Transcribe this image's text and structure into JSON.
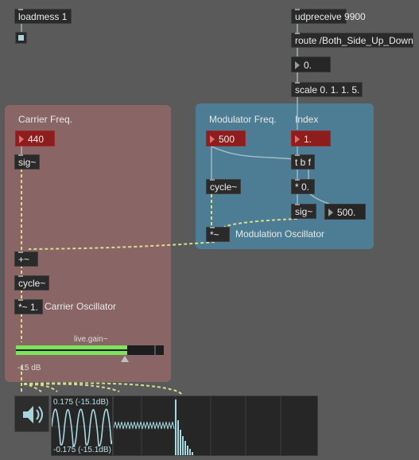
{
  "patcher": {
    "loadmess": "loadmess 1",
    "udpreceive": "udpreceive 9900",
    "route": "route /Both_Side_Up_Down",
    "route_out_value": "0.",
    "scale": "scale 0. 1. 1. 5."
  },
  "carrier_panel": {
    "title": "Carrier Freq.",
    "freq_value": "440",
    "sig": "sig~",
    "plus": "+~",
    "cycle": "cycle~",
    "times": "*~ 1.",
    "comment": "Carrier Oscillator",
    "gain_label": "live.gain~",
    "gain_db": "-15 dB",
    "gain_level": 0.75
  },
  "modulator_panel": {
    "title": "Modulator Freq.",
    "freq_value": "500",
    "cycle": "cycle~",
    "times": "*~",
    "comment": "Modulation Oscillator"
  },
  "index_panel": {
    "title": "Index",
    "index_value": "1.",
    "trigger": "t b f",
    "mult": "* 0.",
    "sig": "sig~",
    "out_value": "500."
  },
  "scope": {
    "max_label": "0.175 (-15.1dB)",
    "min_label": "-0.175 (-15.1dB)"
  },
  "colors": {
    "carrier_panel": "#8a6566",
    "modulator_panel": "#4d7d94",
    "number_red": "#8e1e1e",
    "signal_wire": "#d8dc8a",
    "control_wire": "#a6c4cf",
    "meter_green": "#7ee25a",
    "scope_trace": "#a6d8e0"
  },
  "icons": {
    "speaker": "speaker-icon",
    "toggle": "toggle-check"
  }
}
